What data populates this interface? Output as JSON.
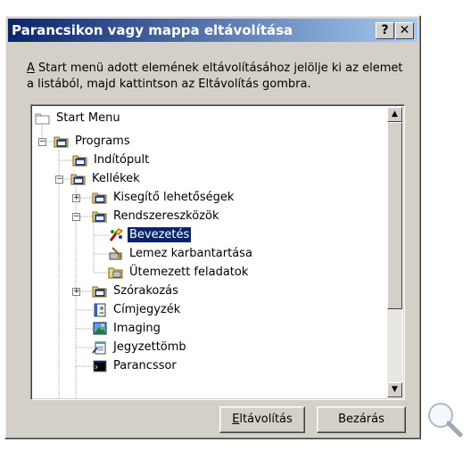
{
  "window": {
    "title": "Parancsikon vagy mappa eltávolítása",
    "help_label": "?",
    "close_label": "✕"
  },
  "description": {
    "accesskey": "A",
    "text": " Start menü adott elemének eltávolításához jelölje ki az elemet a listából, majd kattintson az Eltávolítás gombra."
  },
  "tree": {
    "items": [
      {
        "label": "Start Menu",
        "icon": "folder-icon"
      },
      {
        "label": "Programs",
        "icon": "program-group-icon"
      },
      {
        "label": "Indítópult",
        "icon": "program-group-icon"
      },
      {
        "label": "Kellékek",
        "icon": "program-group-icon"
      },
      {
        "label": "Kisegítő lehetőségek",
        "icon": "program-group-icon"
      },
      {
        "label": "Rendszereszközök",
        "icon": "program-group-icon"
      },
      {
        "label": "Bevezetés",
        "icon": "welcome-icon",
        "selected": true
      },
      {
        "label": "Lemez karbantartása",
        "icon": "disk-cleanup-icon"
      },
      {
        "label": "Ütemezett feladatok",
        "icon": "scheduled-tasks-icon"
      },
      {
        "label": "Szórakozás",
        "icon": "program-group-icon"
      },
      {
        "label": "Címjegyzék",
        "icon": "address-book-icon"
      },
      {
        "label": "Imaging",
        "icon": "imaging-icon"
      },
      {
        "label": "Jegyzettömb",
        "icon": "notepad-icon"
      },
      {
        "label": "Parancssor",
        "icon": "command-prompt-icon"
      }
    ]
  },
  "buttons": {
    "remove_accesskey": "E",
    "remove_rest": "ltávolítás",
    "close_label": "Bezárás"
  },
  "colors": {
    "titlebar_start": "#0a246a",
    "titlebar_end": "#a6caf0",
    "face": "#d4d0c8",
    "selection": "#0a246a"
  }
}
